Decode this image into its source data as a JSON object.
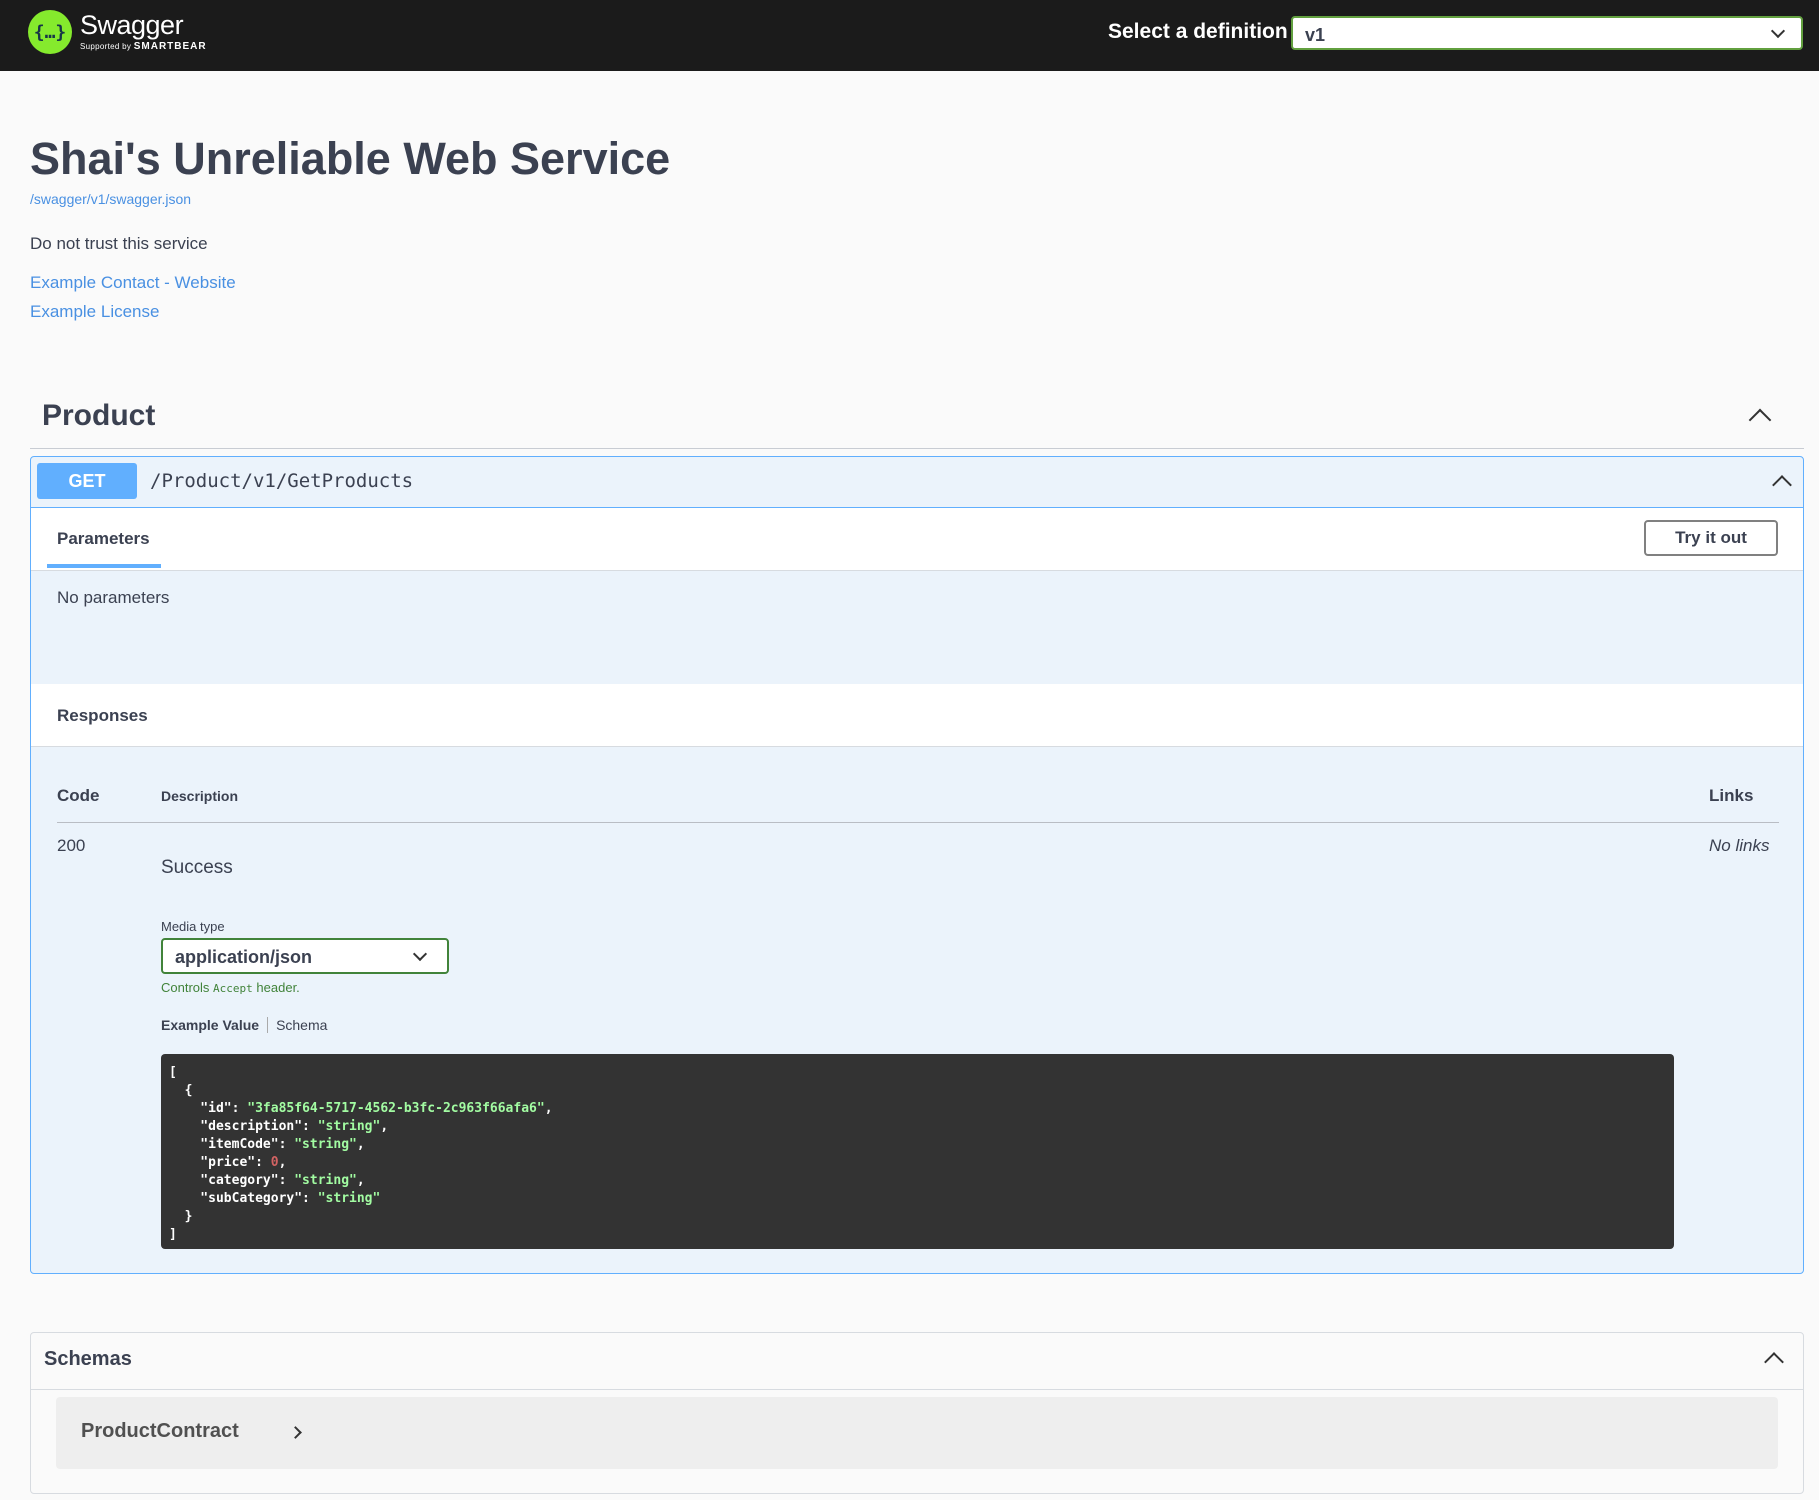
{
  "topbar": {
    "logo_symbol": "{…}",
    "logo_word": "Swagger",
    "logo_sub_prefix": "Supported by",
    "logo_sub_brand": "SMARTBEAR",
    "definition_label": "Select a definition",
    "definition_value": "v1"
  },
  "info": {
    "title": "Shai's Unreliable Web Service",
    "spec_url": "/swagger/v1/swagger.json",
    "description": "Do not trust this service",
    "contact_link": "Example Contact - Website",
    "license_link": "Example License"
  },
  "tag": {
    "name": "Product"
  },
  "operation": {
    "method": "GET",
    "path": "/Product/v1/GetProducts",
    "parameters_tab": "Parameters",
    "try_button": "Try it out",
    "no_parameters": "No parameters",
    "responses_title": "Responses",
    "col_code": "Code",
    "col_description": "Description",
    "col_links": "Links",
    "response": {
      "code": "200",
      "description": "Success",
      "links": "No links",
      "media_label": "Media type",
      "media_value": "application/json",
      "controls_prefix": "Controls",
      "controls_code": "Accept",
      "controls_suffix": "header.",
      "example_tab": "Example Value",
      "schema_tab": "Schema",
      "example_lines": [
        "[",
        "  {",
        "    \"id\": \"3fa85f64-5717-4562-b3fc-2c963f66afa6\",",
        "    \"description\": \"string\",",
        "    \"itemCode\": \"string\",",
        "    \"price\": 0,",
        "    \"category\": \"string\",",
        "    \"subCategory\": \"string\"",
        "  }",
        "]"
      ]
    }
  },
  "schemas": {
    "title": "Schemas",
    "models": [
      "ProductContract"
    ]
  },
  "colors": {
    "topbar_bg": "#1b1b1b",
    "logo_green": "#85ea2d",
    "get_blue": "#61affe",
    "link_blue": "#4990e2",
    "text_dark": "#3b4151",
    "code_bg": "#333333",
    "code_string": "#a2fca2",
    "code_number": "#d36363"
  }
}
